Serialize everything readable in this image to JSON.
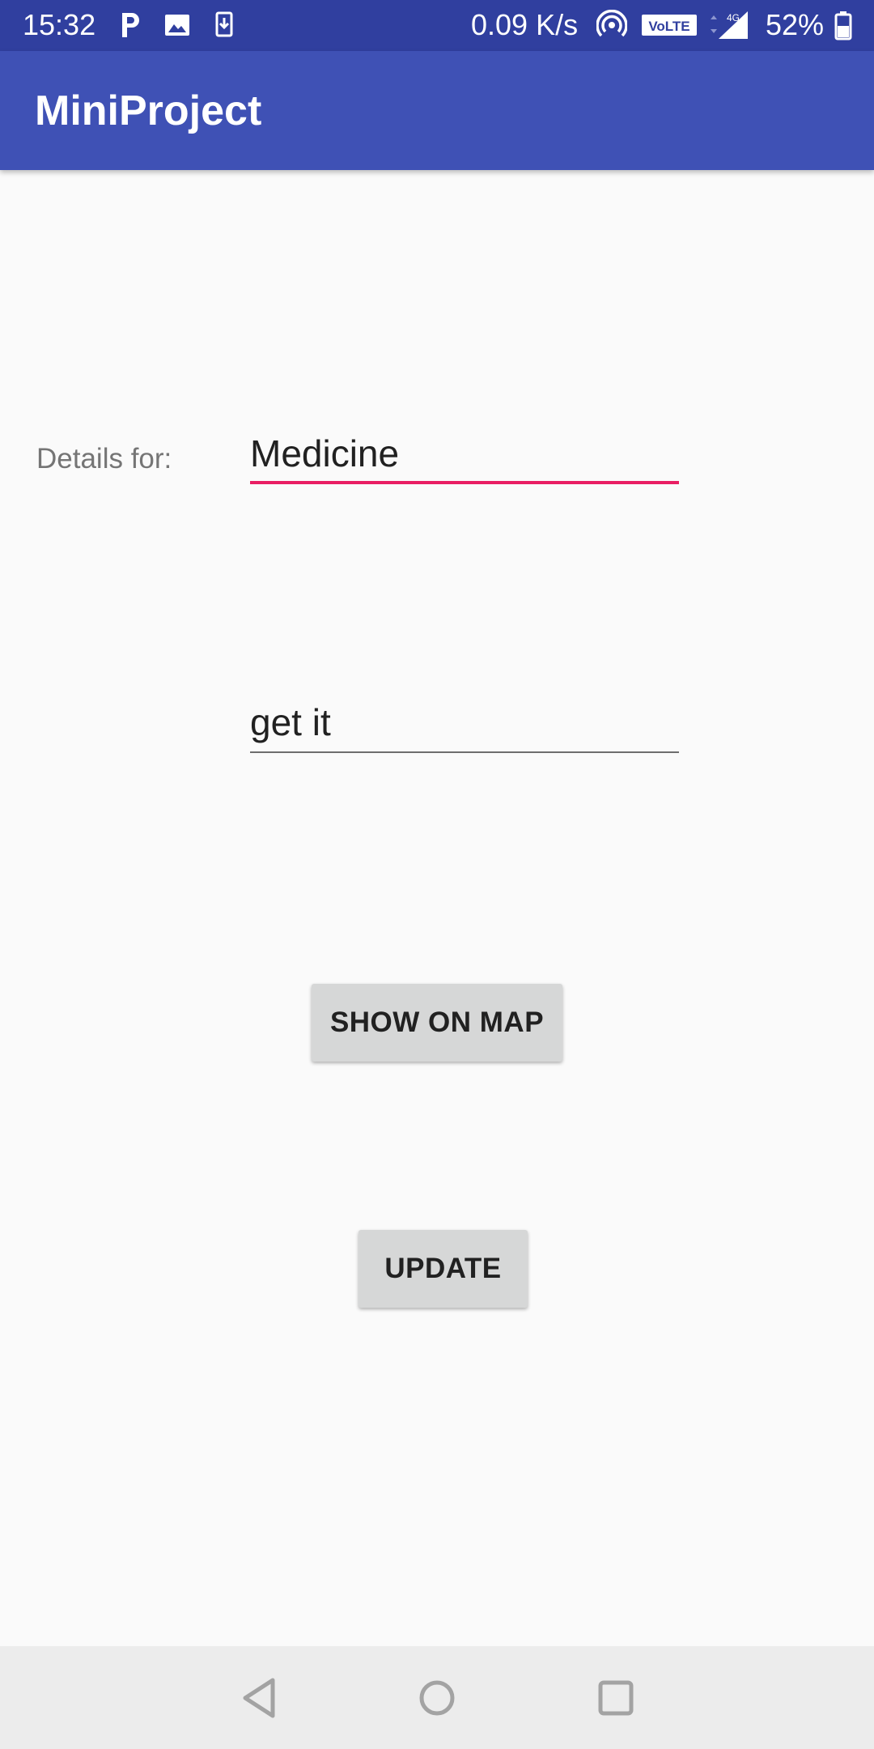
{
  "status_bar": {
    "time": "15:32",
    "network_speed": "0.09 K/s",
    "volte_label": "VoLTE",
    "network_type": "4G",
    "battery": "52%",
    "icons": [
      "parking-icon",
      "image-icon",
      "download-icon",
      "hotspot-icon",
      "volte-icon",
      "signal-icon",
      "battery-icon"
    ]
  },
  "app_bar": {
    "title": "MiniProject"
  },
  "form": {
    "details_label": "Details for:",
    "field1_value": "Medicine",
    "field2_value": "get it"
  },
  "buttons": {
    "show_on_map": "SHOW ON MAP",
    "update": "UPDATE"
  },
  "nav_bar": {
    "icons": [
      "back-icon",
      "home-icon",
      "recents-icon"
    ]
  },
  "colors": {
    "status_bar": "#303f9f",
    "app_bar": "#3f51b5",
    "accent": "#e91e63",
    "button": "#d6d7d7",
    "background": "#fafafa",
    "nav_bar": "#ececec"
  }
}
